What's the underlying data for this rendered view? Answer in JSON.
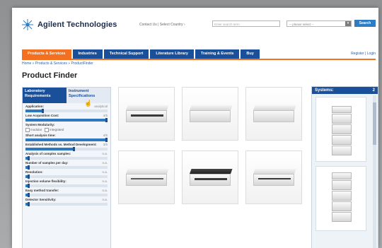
{
  "brand": {
    "name": "Agilent Technologies"
  },
  "header": {
    "top_links": "Contact Us | Select Country ›",
    "search_placeholder": "Enter search term",
    "country_select": "-- please select --",
    "search_button": "Search"
  },
  "nav": {
    "tabs": [
      "Products & Services",
      "Industries",
      "Technical Support",
      "Literature Library",
      "Training & Events",
      "Buy"
    ],
    "register": "Register | Login"
  },
  "breadcrumb": "Home » Products & Services » ProductFinder",
  "page_title": "Product Finder",
  "left_panel": {
    "tab_active": "Laboratory Requirements",
    "tab_other": "Instrument Specifications",
    "criteria": [
      {
        "label": "Application:",
        "value": "analytical",
        "fill": 0.22
      },
      {
        "label": "Low Acquisition Cost:",
        "value": "4/5",
        "fill": 1.0
      },
      {
        "label": "System Modularity:",
        "value": "",
        "fill": null,
        "options": [
          "modular",
          "integrated"
        ]
      },
      {
        "label": "Short analysis time:",
        "value": "4/5",
        "fill": 1.0
      },
      {
        "label": "Established Methods vs. Method Development:",
        "value": "3/5",
        "fill": 0.6
      },
      {
        "label": "Analysis of complex samples:",
        "value": "n.a.",
        "fill": 0.05
      },
      {
        "label": "Number of samples per day:",
        "value": "n.a.",
        "fill": 0.05
      },
      {
        "label": "Resolution:",
        "value": "n.a.",
        "fill": 0.05
      },
      {
        "label": "Injection volume flexibility:",
        "value": "n.a.",
        "fill": 0.05
      },
      {
        "label": "Easy method transfer:",
        "value": "n.a.",
        "fill": 0.05
      },
      {
        "label": "Detector Sensitivity:",
        "value": "n.a.",
        "fill": 0.05
      }
    ]
  },
  "right_panel": {
    "title": "Systems:",
    "count": "2"
  },
  "colors": {
    "nav_blue": "#1a4f99",
    "accent_orange": "#f37021",
    "slider_blue": "#2e78c0"
  }
}
